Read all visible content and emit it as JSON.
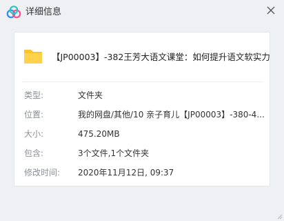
{
  "window": {
    "title": "详细信息",
    "logo_icon": "baidu-netdisk-logo-icon",
    "close_icon": "close-icon"
  },
  "file": {
    "icon": "folder-icon",
    "icon_color": "#f9c42c",
    "name": "【JP00003】-382王芳大语文课堂：如何提升语文软实力"
  },
  "details": {
    "type": {
      "label": "类型:",
      "value": "文件夹"
    },
    "location": {
      "label": "位置:",
      "value": "我的网盘/其他/10 亲子育儿【JP00003】-380-4..."
    },
    "size": {
      "label": "大小:",
      "value": "475.20MB"
    },
    "contains": {
      "label": "包含:",
      "value": "3个文件,1个文件夹"
    },
    "modified": {
      "label": "修改时间:",
      "value": "2020年11月12日, 09:37"
    }
  }
}
